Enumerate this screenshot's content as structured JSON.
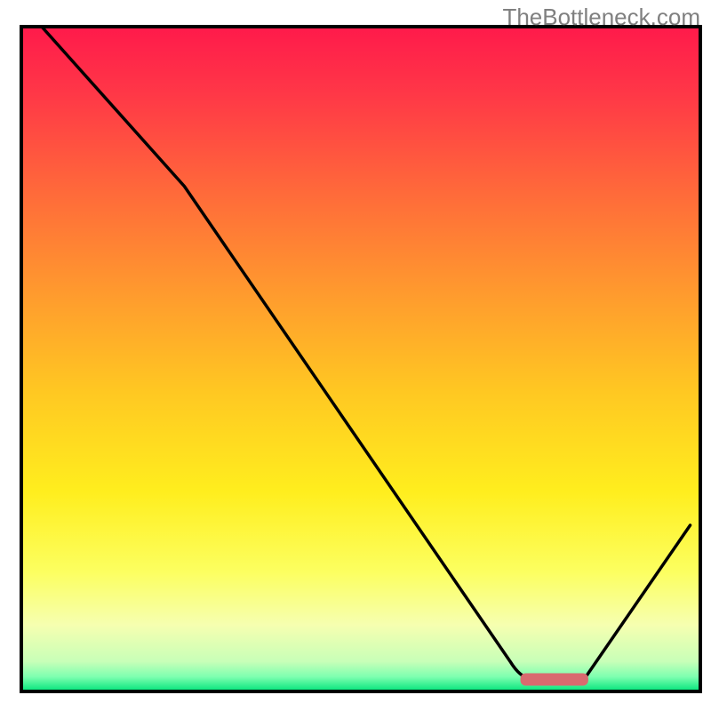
{
  "watermark": "TheBottleneck.com",
  "chart_data": {
    "type": "line",
    "description": "Bottleneck V-curve over a red-to-green vertical heatmap background. Y-axis represents bottleneck severity (top = 100% severe, bottom = 0% optimal). X-axis is an implicit component-pairing axis. Black curve shows mismatch; flat minimum near x≈0.78 marked by a red rounded bar.",
    "xlim": [
      0,
      1
    ],
    "ylim": [
      0,
      1
    ],
    "series": [
      {
        "name": "bottleneck-curve",
        "points": [
          {
            "x": 0.03,
            "y": 1.0
          },
          {
            "x": 0.24,
            "y": 0.76
          },
          {
            "x": 0.72,
            "y": 0.045
          },
          {
            "x": 0.75,
            "y": 0.02
          },
          {
            "x": 0.83,
            "y": 0.02
          },
          {
            "x": 0.985,
            "y": 0.25
          }
        ]
      }
    ],
    "optimal_marker": {
      "x_start": 0.735,
      "x_end": 0.835,
      "y": 0.018,
      "color": "#d96a6f"
    },
    "gradient_stops": [
      {
        "offset": 0.0,
        "color": "#ff1a4b"
      },
      {
        "offset": 0.1,
        "color": "#ff3747"
      },
      {
        "offset": 0.25,
        "color": "#ff6a3a"
      },
      {
        "offset": 0.4,
        "color": "#ff9a2e"
      },
      {
        "offset": 0.55,
        "color": "#ffc822"
      },
      {
        "offset": 0.7,
        "color": "#ffee1e"
      },
      {
        "offset": 0.82,
        "color": "#fcff60"
      },
      {
        "offset": 0.9,
        "color": "#f6ffb0"
      },
      {
        "offset": 0.955,
        "color": "#c8ffb8"
      },
      {
        "offset": 0.978,
        "color": "#7dffb0"
      },
      {
        "offset": 1.0,
        "color": "#00e47a"
      }
    ],
    "frame_color": "#000000",
    "curve_color": "#000000"
  }
}
